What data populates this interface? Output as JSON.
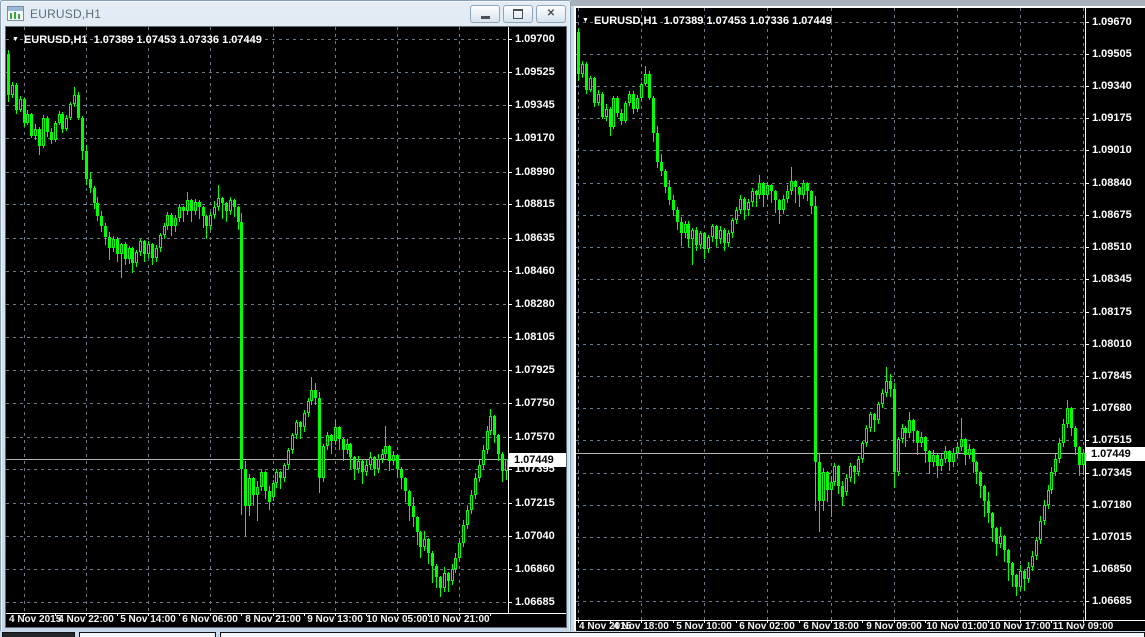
{
  "titlebar": {
    "title": "EURUSD,H1"
  },
  "colors": {
    "background": "#000000",
    "candle": "#00FF00",
    "grid": "#6b7a8a",
    "price_line": "#b4b4b4",
    "axis_text": "#ffffff",
    "separator": "#ffffff",
    "current_price_box_bg": "#ffffff",
    "current_price_box_text": "#000000",
    "window_frame": "#ccdbe9"
  },
  "charts": [
    {
      "name": "left-chart",
      "legend_text": "EURUSD,H1  1.07389 1.07453 1.07336 1.07449",
      "current_price": "1.07449",
      "current_price_value": 1.07449,
      "price_top": 1.09765,
      "price_bottom": 1.06626,
      "first_candle_index": 0,
      "price_labels": [
        "1.09700",
        "1.09525",
        "1.09345",
        "1.09170",
        "1.08990",
        "1.08815",
        "1.08635",
        "1.08460",
        "1.08280",
        "1.08105",
        "1.07925",
        "1.07750",
        "1.07570",
        "1.07395",
        "1.07215",
        "1.07040",
        "1.06860",
        "1.06685"
      ],
      "time_labels": [
        {
          "text": "4 Nov 2015",
          "index": 4
        },
        {
          "text": "4 Nov 22:00",
          "index": 20
        },
        {
          "text": "5 Nov 14:00",
          "index": 36
        },
        {
          "text": "6 Nov 06:00",
          "index": 52
        },
        {
          "text": "8 Nov 21:00",
          "index": 68
        },
        {
          "text": "9 Nov 13:00",
          "index": 84
        },
        {
          "text": "10 Nov 05:00",
          "index": 100
        },
        {
          "text": "10 Nov 21:00",
          "index": 116
        }
      ]
    },
    {
      "name": "right-chart",
      "legend_text": "EURUSD,H1  1.07389 1.07453 1.07336 1.07449",
      "current_price": "1.07449",
      "current_price_value": 1.07449,
      "price_top": 1.09742,
      "price_bottom": 1.06588,
      "first_candle_index": 0,
      "price_labels": [
        "1.09670",
        "1.09505",
        "1.09340",
        "1.09175",
        "1.09010",
        "1.08840",
        "1.08675",
        "1.08510",
        "1.08345",
        "1.08175",
        "1.08010",
        "1.07845",
        "1.07680",
        "1.07515",
        "1.07345",
        "1.07180",
        "1.07015",
        "1.06850",
        "1.06685"
      ],
      "time_labels": [
        {
          "text": "4 Nov 2015",
          "index": 0
        },
        {
          "text": "4 Nov 18:00",
          "index": 16
        },
        {
          "text": "5 Nov 10:00",
          "index": 32
        },
        {
          "text": "6 Nov 02:00",
          "index": 48
        },
        {
          "text": "6 Nov 18:00",
          "index": 64
        },
        {
          "text": "9 Nov 09:00",
          "index": 80
        },
        {
          "text": "10 Nov 01:00",
          "index": 96
        },
        {
          "text": "10 Nov 17:00",
          "index": 112
        },
        {
          "text": "11 Nov 09:00",
          "index": 128
        }
      ]
    }
  ],
  "chart_data": {
    "type": "candlestick",
    "symbol": "EURUSD",
    "timeframe": "H1",
    "title": "EURUSD,H1",
    "ohlc_legend": {
      "open": "1.07389",
      "high": "1.07453",
      "low": "1.07336",
      "close": "1.07449"
    },
    "candles": [
      [
        1.0962,
        1.0964,
        1.09365,
        1.094
      ],
      [
        1.094,
        1.09468,
        1.09382,
        1.09455
      ],
      [
        1.09455,
        1.09463,
        1.09298,
        1.0932
      ],
      [
        1.0932,
        1.09393,
        1.09308,
        1.0938
      ],
      [
        1.0938,
        1.09386,
        1.09232,
        1.0925
      ],
      [
        1.0925,
        1.09319,
        1.09238,
        1.093
      ],
      [
        1.093,
        1.09307,
        1.09168,
        1.0918
      ],
      [
        1.0918,
        1.09246,
        1.09158,
        1.0922
      ],
      [
        1.0922,
        1.09232,
        1.09082,
        1.0913
      ],
      [
        1.0913,
        1.09291,
        1.09118,
        1.0928
      ],
      [
        1.0928,
        1.09287,
        1.09178,
        1.092
      ],
      [
        1.092,
        1.09222,
        1.09138,
        1.0916
      ],
      [
        1.0916,
        1.09261,
        1.09148,
        1.0925
      ],
      [
        1.0925,
        1.09316,
        1.09238,
        1.093
      ],
      [
        1.093,
        1.09312,
        1.09198,
        1.0922
      ],
      [
        1.0922,
        1.09292,
        1.09208,
        1.0928
      ],
      [
        1.0928,
        1.09361,
        1.09268,
        1.0935
      ],
      [
        1.0935,
        1.09441,
        1.09338,
        1.094
      ],
      [
        1.094,
        1.09416,
        1.09268,
        1.0928
      ],
      [
        1.0928,
        1.09287,
        1.09052,
        1.091
      ],
      [
        1.091,
        1.09132,
        1.08918,
        1.0895
      ],
      [
        1.0895,
        1.08987,
        1.08878,
        1.089
      ],
      [
        1.089,
        1.08912,
        1.08788,
        1.0882
      ],
      [
        1.0882,
        1.08856,
        1.08728,
        1.0875
      ],
      [
        1.0875,
        1.08777,
        1.08668,
        1.087
      ],
      [
        1.087,
        1.08716,
        1.08598,
        1.0864
      ],
      [
        1.0864,
        1.08667,
        1.08518,
        1.0858
      ],
      [
        1.0858,
        1.08646,
        1.08558,
        1.0863
      ],
      [
        1.0863,
        1.08642,
        1.08508,
        1.0855
      ],
      [
        1.0855,
        1.08607,
        1.0842,
        1.086
      ],
      [
        1.086,
        1.08612,
        1.08488,
        1.0852
      ],
      [
        1.0852,
        1.08591,
        1.08498,
        1.0858
      ],
      [
        1.0858,
        1.08586,
        1.08448,
        1.085
      ],
      [
        1.085,
        1.08571,
        1.08478,
        1.0856
      ],
      [
        1.0856,
        1.08631,
        1.08538,
        1.0862
      ],
      [
        1.0862,
        1.08626,
        1.08508,
        1.0855
      ],
      [
        1.0855,
        1.08616,
        1.08528,
        1.086
      ],
      [
        1.086,
        1.08606,
        1.08488,
        1.0853
      ],
      [
        1.0853,
        1.08596,
        1.08508,
        1.0858
      ],
      [
        1.0858,
        1.08661,
        1.08558,
        1.0865
      ],
      [
        1.0865,
        1.08716,
        1.08628,
        1.087
      ],
      [
        1.087,
        1.08776,
        1.08678,
        1.0876
      ],
      [
        1.0876,
        1.08766,
        1.08648,
        1.087
      ],
      [
        1.087,
        1.08756,
        1.08668,
        1.0874
      ],
      [
        1.0874,
        1.08816,
        1.08718,
        1.088
      ],
      [
        1.088,
        1.08806,
        1.08718,
        1.0878
      ],
      [
        1.0878,
        1.08881,
        1.08758,
        1.0884
      ],
      [
        1.0884,
        1.08846,
        1.08718,
        1.0878
      ],
      [
        1.0878,
        1.08846,
        1.08758,
        1.0883
      ],
      [
        1.0883,
        1.08836,
        1.08738,
        1.088
      ],
      [
        1.088,
        1.08806,
        1.08688,
        1.0875
      ],
      [
        1.0875,
        1.08756,
        1.08628,
        1.087
      ],
      [
        1.087,
        1.08776,
        1.08678,
        1.0876
      ],
      [
        1.0876,
        1.08831,
        1.08738,
        1.088
      ],
      [
        1.088,
        1.08921,
        1.08778,
        1.0885
      ],
      [
        1.0885,
        1.08856,
        1.08738,
        1.0882
      ],
      [
        1.0882,
        1.08826,
        1.08718,
        1.0878
      ],
      [
        1.0878,
        1.08856,
        1.08758,
        1.0884
      ],
      [
        1.0884,
        1.08846,
        1.08748,
        1.088
      ],
      [
        1.088,
        1.08806,
        1.08678,
        1.0872
      ],
      [
        1.0872,
        1.08771,
        1.0715,
        1.074
      ],
      [
        1.074,
        1.07441,
        1.0704,
        1.072
      ],
      [
        1.072,
        1.07371,
        1.07148,
        1.0735
      ],
      [
        1.0735,
        1.07356,
        1.07198,
        1.0726
      ],
      [
        1.0726,
        1.07331,
        1.07118,
        1.073
      ],
      [
        1.073,
        1.07396,
        1.07278,
        1.0738
      ],
      [
        1.0738,
        1.07386,
        1.07238,
        1.0728
      ],
      [
        1.0728,
        1.07306,
        1.07178,
        1.0722
      ],
      [
        1.0725,
        1.07341,
        1.07228,
        1.0732
      ],
      [
        1.0732,
        1.07396,
        1.07298,
        1.0738
      ],
      [
        1.0738,
        1.07386,
        1.07288,
        1.0735
      ],
      [
        1.0735,
        1.07431,
        1.07328,
        1.0742
      ],
      [
        1.0742,
        1.07511,
        1.07398,
        1.075
      ],
      [
        1.075,
        1.07591,
        1.07478,
        1.0758
      ],
      [
        1.0758,
        1.07661,
        1.07558,
        1.0765
      ],
      [
        1.0765,
        1.07656,
        1.07558,
        1.0762
      ],
      [
        1.0762,
        1.07711,
        1.07598,
        1.077
      ],
      [
        1.077,
        1.07776,
        1.07678,
        1.0776
      ],
      [
        1.0776,
        1.0789,
        1.07738,
        1.0782
      ],
      [
        1.0782,
        1.07856,
        1.07738,
        1.0778
      ],
      [
        1.0778,
        1.07811,
        1.0727,
        1.0735
      ],
      [
        1.0735,
        1.07531,
        1.07328,
        1.0752
      ],
      [
        1.0752,
        1.07596,
        1.07498,
        1.0758
      ],
      [
        1.0758,
        1.07586,
        1.07478,
        1.0755
      ],
      [
        1.0755,
        1.07661,
        1.07528,
        1.0762
      ],
      [
        1.0762,
        1.07626,
        1.07498,
        1.0756
      ],
      [
        1.0756,
        1.07566,
        1.07438,
        1.075
      ],
      [
        1.075,
        1.07556,
        1.07478,
        1.0753
      ],
      [
        1.0753,
        1.07536,
        1.07398,
        1.0746
      ],
      [
        1.0746,
        1.07466,
        1.07338,
        1.074
      ],
      [
        1.074,
        1.07466,
        1.07378,
        1.0744
      ],
      [
        1.0744,
        1.07446,
        1.07318,
        1.0738
      ],
      [
        1.0738,
        1.07446,
        1.07358,
        1.0742
      ],
      [
        1.0742,
        1.07486,
        1.07398,
        1.0746
      ],
      [
        1.0746,
        1.07466,
        1.07358,
        1.074
      ],
      [
        1.074,
        1.07476,
        1.07378,
        1.0745
      ],
      [
        1.0745,
        1.07506,
        1.07428,
        1.0748
      ],
      [
        1.0748,
        1.0763,
        1.07458,
        1.0752
      ],
      [
        1.0752,
        1.07526,
        1.07388,
        1.0744
      ],
      [
        1.0744,
        1.07496,
        1.07418,
        1.0747
      ],
      [
        1.0747,
        1.07476,
        1.07348,
        1.074
      ],
      [
        1.074,
        1.07406,
        1.07288,
        1.0735
      ],
      [
        1.0735,
        1.07356,
        1.07218,
        1.0728
      ],
      [
        1.0728,
        1.07286,
        1.07118,
        1.072
      ],
      [
        1.072,
        1.07246,
        1.07088,
        1.0714
      ],
      [
        1.0714,
        1.07146,
        1.06988,
        1.0706
      ],
      [
        1.0706,
        1.07066,
        1.06918,
        1.0698
      ],
      [
        1.0698,
        1.07066,
        1.06958,
        1.0702
      ],
      [
        1.0702,
        1.07026,
        1.06888,
        1.0695
      ],
      [
        1.0695,
        1.06956,
        1.06788,
        1.0688
      ],
      [
        1.0688,
        1.06886,
        1.06758,
        1.0682
      ],
      [
        1.0682,
        1.06826,
        1.0671,
        1.0676
      ],
      [
        1.0676,
        1.06871,
        1.06738,
        1.0684
      ],
      [
        1.0684,
        1.06846,
        1.06738,
        1.068
      ],
      [
        1.068,
        1.06886,
        1.06778,
        1.0686
      ],
      [
        1.0686,
        1.06946,
        1.06838,
        1.0692
      ],
      [
        1.0692,
        1.07016,
        1.06898,
        1.07
      ],
      [
        1.07,
        1.07126,
        1.06978,
        1.071
      ],
      [
        1.071,
        1.07206,
        1.07078,
        1.0718
      ],
      [
        1.0718,
        1.07286,
        1.07158,
        1.0726
      ],
      [
        1.0726,
        1.07376,
        1.07238,
        1.0735
      ],
      [
        1.0735,
        1.07446,
        1.07328,
        1.0742
      ],
      [
        1.0742,
        1.07526,
        1.07398,
        1.075
      ],
      [
        1.075,
        1.07626,
        1.07478,
        1.076
      ],
      [
        1.076,
        1.0772,
        1.07578,
        1.0768
      ],
      [
        1.0768,
        1.07686,
        1.07538,
        1.0758
      ],
      [
        1.0758,
        1.07586,
        1.07438,
        1.0748
      ],
      [
        1.0748,
        1.07486,
        1.07328,
        1.07389
      ],
      [
        1.07389,
        1.07453,
        1.07336,
        1.07449
      ]
    ]
  }
}
